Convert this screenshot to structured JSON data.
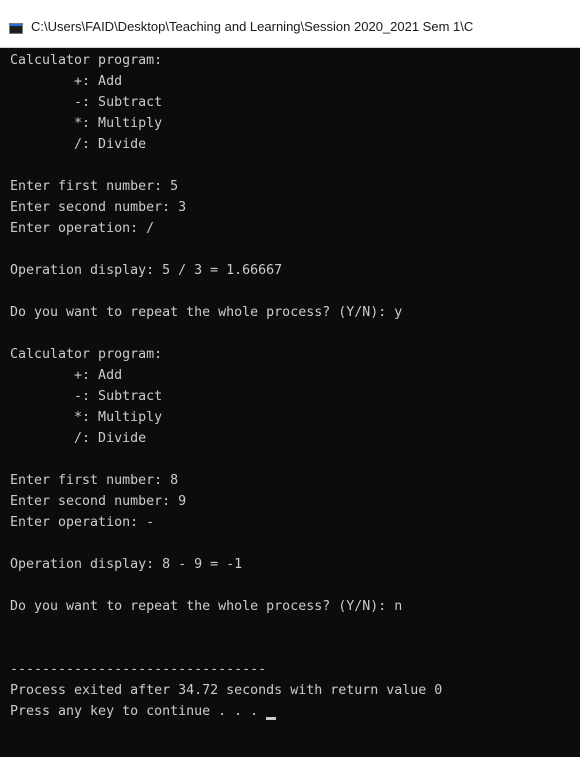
{
  "window": {
    "title": "C:\\Users\\FAID\\Desktop\\Teaching and Learning\\Session 2020_2021 Sem 1\\C",
    "icon": "console-app-icon"
  },
  "console": {
    "background": "#0c0c0c",
    "foreground": "#cccccc",
    "lines": [
      "Calculator program:",
      "        +: Add",
      "        -: Subtract",
      "        *: Multiply",
      "        /: Divide",
      "",
      "Enter first number: 5",
      "Enter second number: 3",
      "Enter operation: /",
      "",
      "Operation display: 5 / 3 = 1.66667",
      "",
      "Do you want to repeat the whole process? (Y/N): y",
      "",
      "Calculator program:",
      "        +: Add",
      "        -: Subtract",
      "        *: Multiply",
      "        /: Divide",
      "",
      "Enter first number: 8",
      "Enter second number: 9",
      "Enter operation: -",
      "",
      "Operation display: 8 - 9 = -1",
      "",
      "Do you want to repeat the whole process? (Y/N): n",
      "",
      "",
      "--------------------------------",
      "Process exited after 34.72 seconds with return value 0",
      "Press any key to continue . . . "
    ]
  }
}
